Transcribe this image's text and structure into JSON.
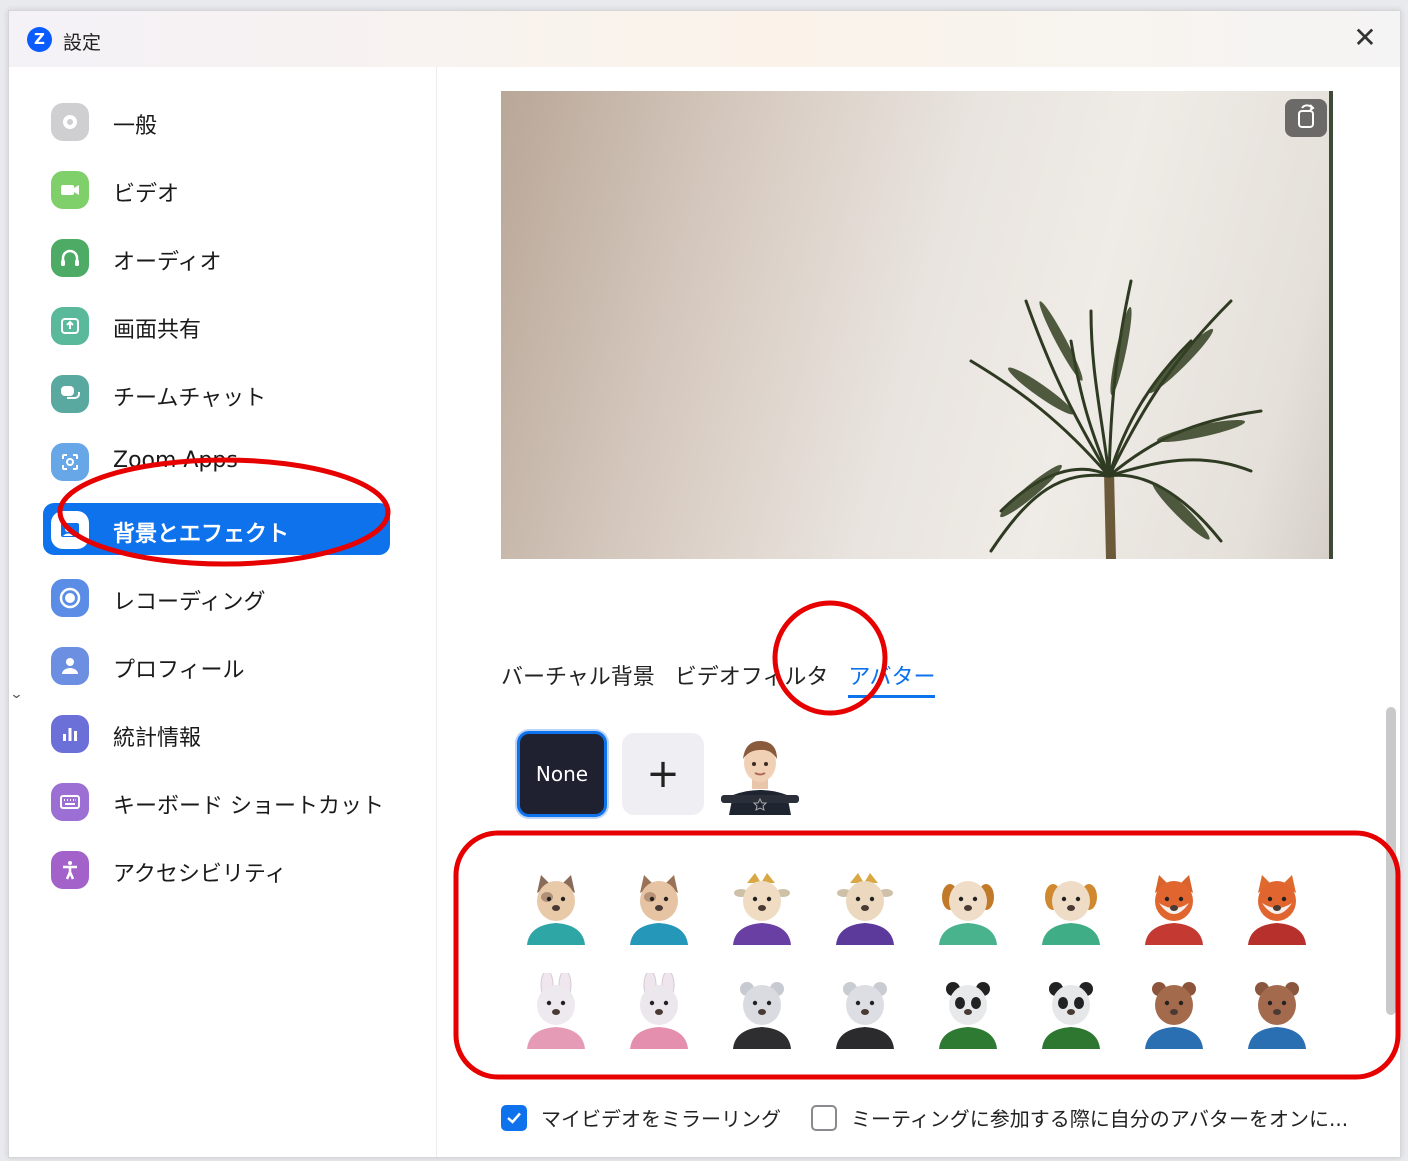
{
  "window": {
    "title": "設定",
    "close_label": "✕",
    "logo_letter": "Z"
  },
  "sidebar": {
    "items": [
      {
        "label": "一般",
        "icon": "gear-icon",
        "color": "#cfcfd2"
      },
      {
        "label": "ビデオ",
        "icon": "video-camera-icon",
        "color": "#7fd06a"
      },
      {
        "label": "オーディオ",
        "icon": "headphones-icon",
        "color": "#4dab66"
      },
      {
        "label": "画面共有",
        "icon": "share-screen-icon",
        "color": "#59b99a"
      },
      {
        "label": "チームチャット",
        "icon": "chat-icon",
        "color": "#5aa9a0"
      },
      {
        "label": "Zoom Apps",
        "icon": "apps-icon",
        "color": "#67a7e8"
      },
      {
        "label": "背景とエフェクト",
        "icon": "background-icon",
        "color": "#ffffff",
        "active": true
      },
      {
        "label": "レコーディング",
        "icon": "record-icon",
        "color": "#5b8de6"
      },
      {
        "label": "プロフィール",
        "icon": "profile-icon",
        "color": "#6c8fe2"
      },
      {
        "label": "統計情報",
        "icon": "statistics-icon",
        "color": "#6b6fd8"
      },
      {
        "label": "キーボード ショートカット",
        "icon": "keyboard-icon",
        "color": "#9b6fd4"
      },
      {
        "label": "アクセシビリティ",
        "icon": "accessibility-icon",
        "color": "#a362c9"
      }
    ]
  },
  "tabs": [
    {
      "label": "バーチャル背景",
      "active": false
    },
    {
      "label": "ビデオフィルタ",
      "active": false
    },
    {
      "label": "アバター",
      "active": true
    }
  ],
  "avatar_controls": {
    "none_label": "None",
    "add_label": "+"
  },
  "avatars": [
    {
      "name": "cat",
      "shirt": "#2fa6a6",
      "face": "#e8c9a8",
      "ear": "#8a6a58"
    },
    {
      "name": "cat",
      "shirt": "#2597b8",
      "face": "#e6c3a2",
      "ear": "#9a7258"
    },
    {
      "name": "cow",
      "shirt": "#6a3fa3",
      "face": "#efdcc2",
      "ear": "#d9a844"
    },
    {
      "name": "cow",
      "shirt": "#5c3a9c",
      "face": "#ecd8be",
      "ear": "#d9a844"
    },
    {
      "name": "dog",
      "shirt": "#49b38e",
      "face": "#f0ddc7",
      "ear": "#c07a2a"
    },
    {
      "name": "dog",
      "shirt": "#3fae86",
      "face": "#efdcc6",
      "ear": "#d0892f"
    },
    {
      "name": "fox",
      "shirt": "#c43a33",
      "face": "#f7e9e3",
      "ear": "#d9632b"
    },
    {
      "name": "fox",
      "shirt": "#b8302c",
      "face": "#f7e8e1",
      "ear": "#e06a2e"
    },
    {
      "name": "rabbit",
      "shirt": "#e59bb5",
      "face": "#eee8ef",
      "ear": "#f0e6ee"
    },
    {
      "name": "rabbit",
      "shirt": "#e58fae",
      "face": "#ece6ed",
      "ear": "#efe5ec"
    },
    {
      "name": "polar-bear",
      "shirt": "#2e2e30",
      "face": "#d9dbe0",
      "ear": "#c8cad1"
    },
    {
      "name": "polar-bear",
      "shirt": "#2b2b2d",
      "face": "#dcdee3",
      "ear": "#caccd3"
    },
    {
      "name": "panda",
      "shirt": "#2f7a33",
      "face": "#e8e9ea",
      "ear": "#222222"
    },
    {
      "name": "panda",
      "shirt": "#2d7730",
      "face": "#e6e7e8",
      "ear": "#222222"
    },
    {
      "name": "otter",
      "shirt": "#2a6fb2",
      "face": "#a46a4c",
      "ear": "#8c553b"
    },
    {
      "name": "otter",
      "shirt": "#2a6fb2",
      "face": "#a36a4e",
      "ear": "#8a563d"
    }
  ],
  "options": {
    "mirror_label": "マイビデオをミラーリング",
    "mirror_checked": true,
    "avatar_on_join_label": "ミーティングに参加する際に自分のアバターをオンに...",
    "avatar_on_join_checked": false
  },
  "accent_color": "#0e72ed",
  "annotation_color": "#e60000"
}
